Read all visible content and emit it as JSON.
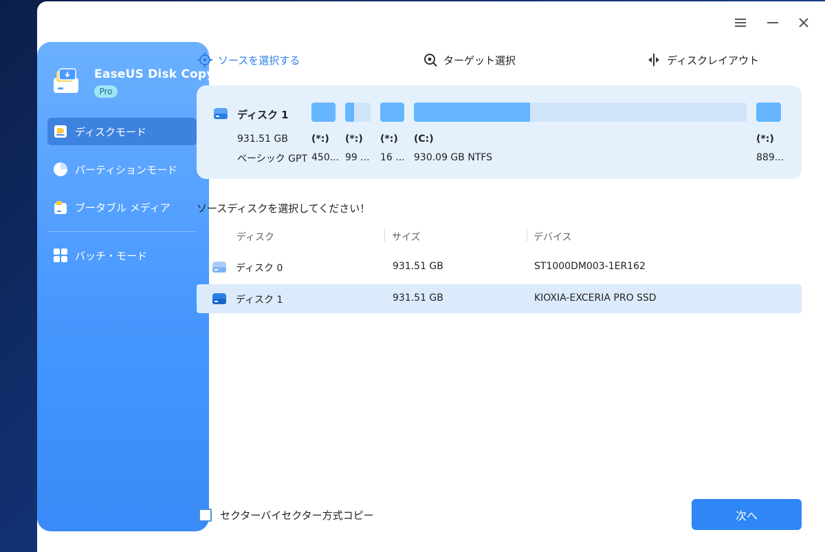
{
  "app": {
    "name": "EaseUS Disk Copy",
    "edition": "Pro"
  },
  "titlebar": {
    "menu_icon": "hamburger-icon",
    "minimize_icon": "minimize-icon",
    "close_icon": "close-icon"
  },
  "sidebar": {
    "items": [
      {
        "label": "ディスクモード",
        "icon": "disk-mode-icon",
        "active": true
      },
      {
        "label": "パーティションモード",
        "icon": "partition-pie-icon",
        "active": false
      },
      {
        "label": "ブータブル メディア",
        "icon": "bootable-media-icon",
        "active": false
      },
      {
        "label": "バッチ・モード",
        "icon": "batch-grid-icon",
        "active": false
      }
    ]
  },
  "steps": {
    "source": "ソースを選択する",
    "target": "ターゲット選択",
    "layout": "ディスクレイアウト"
  },
  "disk_card": {
    "name": "ディスク 1",
    "size": "931.51 GB",
    "type": "ベーシック GPT",
    "partitions": [
      {
        "label": "(*:)",
        "size": "450...",
        "fill": 1.0
      },
      {
        "label": "(*:)",
        "size": "99 ...",
        "fill": 0.35
      },
      {
        "label": "(*:)",
        "size": "16 ...",
        "fill": 1.0
      },
      {
        "label": "(C:)",
        "size": "930.09 GB NTFS",
        "fill": 0.35
      },
      {
        "label": "(*:)",
        "size": "889...",
        "fill": 1.0
      }
    ]
  },
  "select_prompt": "ソースディスクを選択してください！",
  "table": {
    "headers": {
      "disk": "ディスク",
      "size": "サイズ",
      "device": "デバイス"
    },
    "rows": [
      {
        "disk": "ディスク 0",
        "size": "931.51 GB",
        "device": "ST1000DM003-1ER162",
        "selected": false
      },
      {
        "disk": "ディスク 1",
        "size": "931.51 GB",
        "device": "KIOXIA-EXCERIA PRO SSD",
        "selected": true
      }
    ]
  },
  "options": {
    "sector_copy_label": "セクターバイセクター方式コピー",
    "sector_copy_checked": false
  },
  "buttons": {
    "next": "次へ"
  },
  "colors": {
    "accent": "#2f86f6",
    "sidebar_top": "#6bb0ff",
    "sidebar_bottom": "#3a8af7",
    "partition_fill": "#66b6ff",
    "card_bg": "#e4f1fd"
  }
}
